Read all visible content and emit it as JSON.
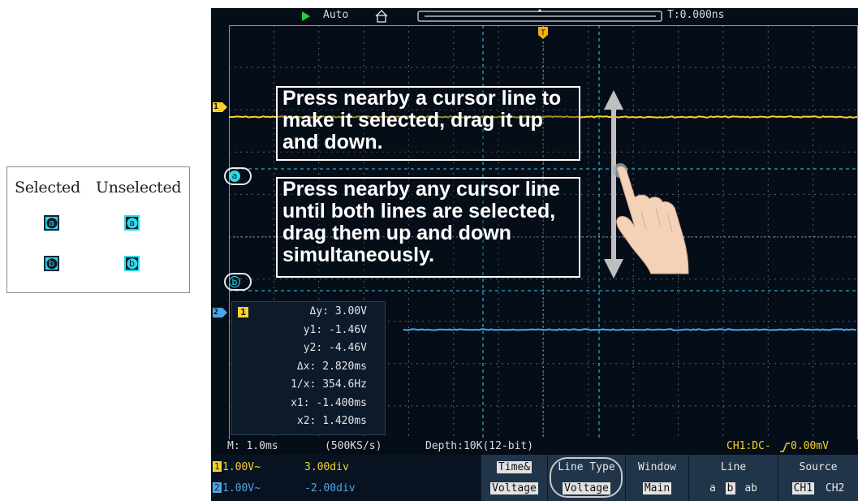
{
  "legend": {
    "selected_label": "Selected",
    "unselected_label": "Unselected",
    "marker_a": "a",
    "marker_b": "b"
  },
  "scope": {
    "top": {
      "run_mode": "Auto",
      "trigger_time": "T:0.000ns"
    },
    "cursor_markers": {
      "a": "a",
      "b": "b",
      "ch1": "1",
      "ch2": "2"
    },
    "instructions": {
      "single": "Press nearby a cursor line to make it selected, drag it up and down.",
      "both": "Press nearby any cursor line until both lines are selected, drag them up and down simultaneously."
    },
    "measurement": {
      "channel": "1",
      "rows": [
        {
          "label": "Δy:",
          "value": "3.00V"
        },
        {
          "label": "y1:",
          "value": "-1.46V"
        },
        {
          "label": "y2:",
          "value": "-4.46V"
        },
        {
          "label": "Δx:",
          "value": "2.820ms"
        },
        {
          "label": "1/x:",
          "value": "354.6Hz"
        },
        {
          "label": "x1:",
          "value": "-1.400ms"
        },
        {
          "label": "x2:",
          "value": "1.420ms"
        }
      ]
    },
    "status": {
      "timebase": "M: 1.0ms",
      "sample_rate": "(500KS/s)",
      "depth": "Depth:10K(12-bit)",
      "trigger_prefix": "CH1:DC-",
      "trigger_level": "0.00mV"
    },
    "channels": [
      {
        "num": "1",
        "scale": "1.00V~",
        "cursor_div": "3.00div",
        "color": "#f6d22b"
      },
      {
        "num": "2",
        "scale": "1.00V~",
        "cursor_div": "-2.00div",
        "color": "#4aa8e6"
      }
    ],
    "menu": {
      "mode_label": "Time&",
      "mode_value": "Voltage",
      "line_type_label": "Line Type",
      "line_type_value": "Voltage",
      "window_label": "Window",
      "window_value": "Main",
      "line_label": "Line",
      "line_options": [
        "a",
        "b",
        "ab"
      ],
      "source_label": "Source",
      "source_options": [
        "CH1",
        "CH2"
      ]
    },
    "colors": {
      "ch1": "#f6d22b",
      "ch2": "#4aa8e6",
      "cursor": "#2fd8e8",
      "grid": "#5a6472",
      "trigger": "#f6b400"
    }
  }
}
